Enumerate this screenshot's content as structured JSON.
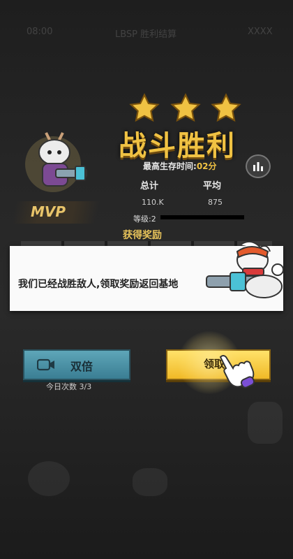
{
  "header": {
    "left_text": "08:00",
    "center_text": "LBSP 胜利结算",
    "right_text": "XXXX"
  },
  "result": {
    "stars": 3,
    "title": "战斗胜利",
    "survive_label": "最高生存时间:",
    "survive_value": "02分",
    "stats_total_label": "总计",
    "stats_avg_label": "平均",
    "stats_total_value": "110.K",
    "stats_avg_value": "875",
    "level_label": "等级:2"
  },
  "mvp": {
    "label": "MVP"
  },
  "rewards": {
    "title": "获得奖励"
  },
  "dialog": {
    "message": "我们已经战胜敌人,领取奖励返回基地"
  },
  "buttons": {
    "double_label": "双倍",
    "double_count": "今日次数 3/3",
    "claim_label": "领取"
  },
  "icons": [
    "star-icon",
    "leaderboard-icon",
    "video-icon",
    "pointing-hand-icon"
  ],
  "colors": {
    "gold": "#f0c243",
    "teal": "#4a93a7",
    "yellow": "#f7cd3b"
  }
}
